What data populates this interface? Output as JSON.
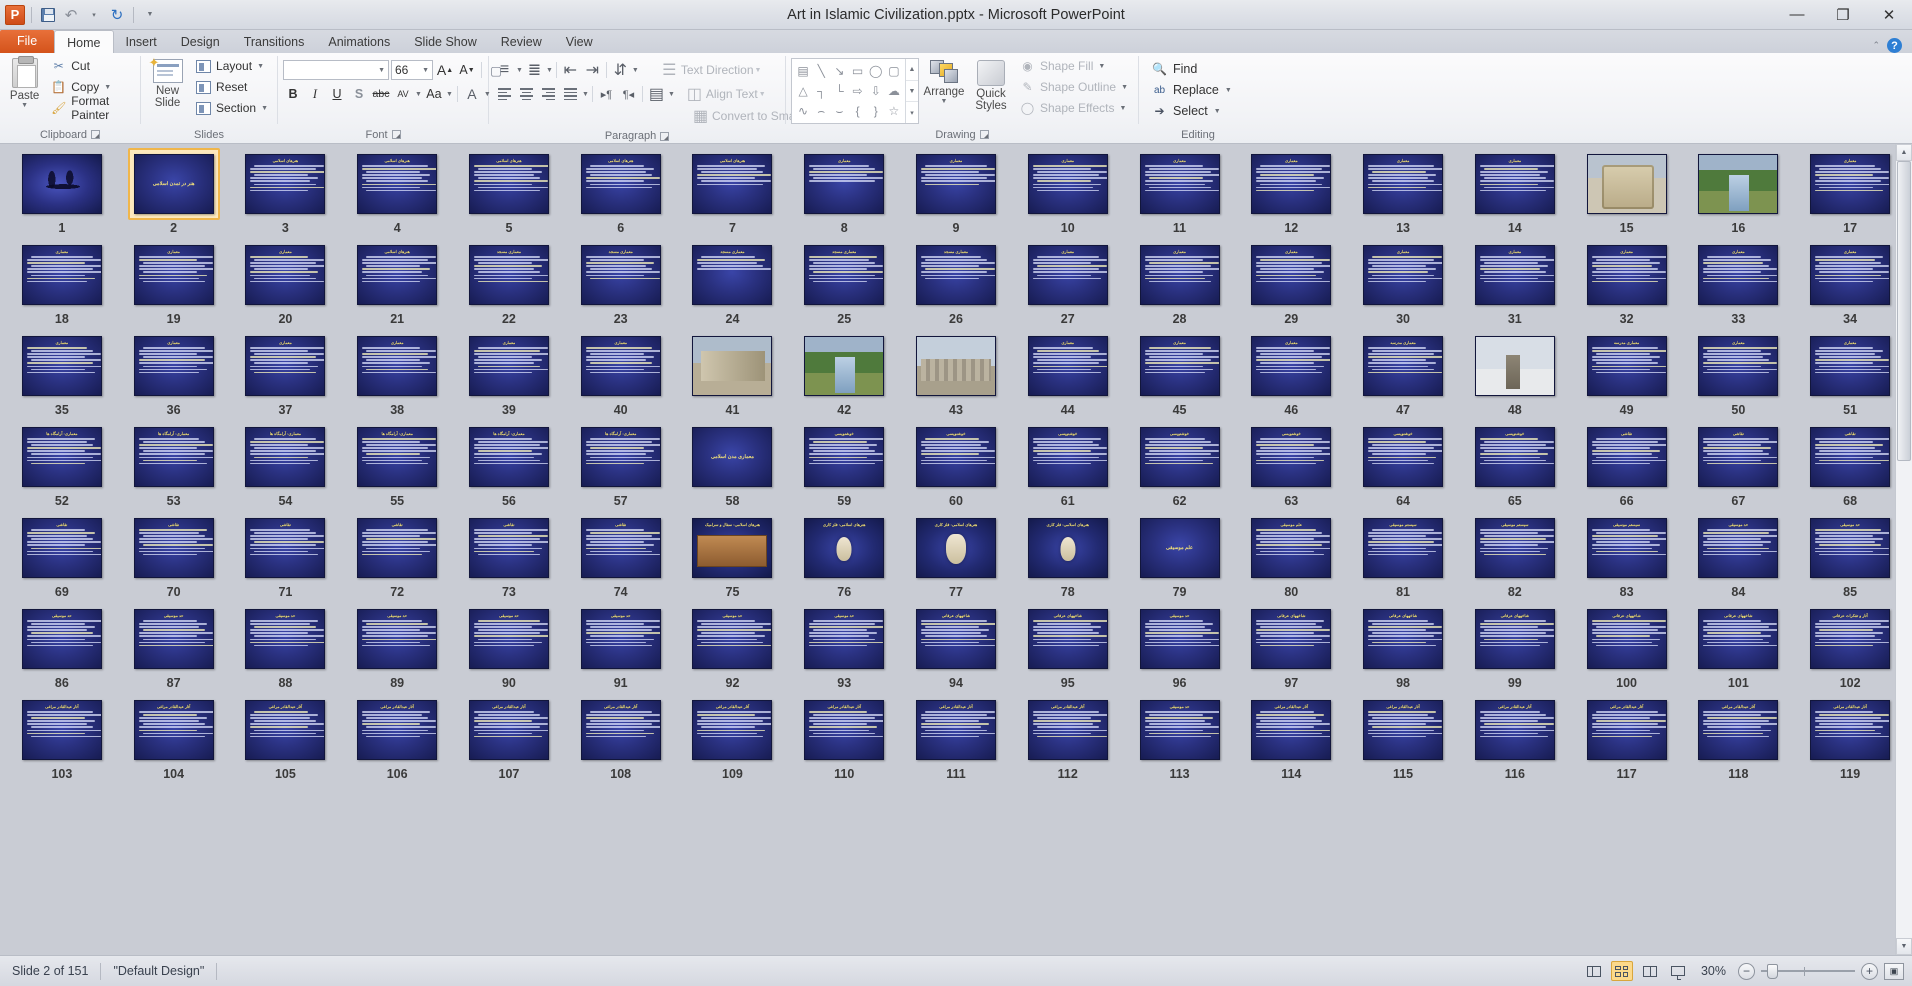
{
  "window": {
    "title": "Art in Islamic Civilization.pptx  -  Microsoft PowerPoint",
    "app_logo": "powerpoint-logo",
    "minimize": "—",
    "restore": "❐",
    "close": "✕"
  },
  "quick_access": {
    "save": "save-icon",
    "undo": "↶",
    "redo": "↺",
    "customize": "▾"
  },
  "tabs": [
    {
      "label": "File",
      "active": false,
      "special": true
    },
    {
      "label": "Home",
      "active": true
    },
    {
      "label": "Insert",
      "active": false
    },
    {
      "label": "Design",
      "active": false
    },
    {
      "label": "Transitions",
      "active": false
    },
    {
      "label": "Animations",
      "active": false
    },
    {
      "label": "Slide Show",
      "active": false
    },
    {
      "label": "Review",
      "active": false
    },
    {
      "label": "View",
      "active": false
    }
  ],
  "help": {
    "collapse": "⌃",
    "question": "?"
  },
  "ribbon": {
    "groups": [
      {
        "name": "Clipboard",
        "label": "Clipboard",
        "has_launcher": true
      },
      {
        "name": "Slides",
        "label": "Slides",
        "has_launcher": false
      },
      {
        "name": "Font",
        "label": "Font",
        "has_launcher": true
      },
      {
        "name": "Paragraph",
        "label": "Paragraph",
        "has_launcher": true
      },
      {
        "name": "Drawing",
        "label": "Drawing",
        "has_launcher": true
      },
      {
        "name": "Editing",
        "label": "Editing",
        "has_launcher": false
      }
    ],
    "clipboard": {
      "paste": "Paste",
      "cut": "Cut",
      "copy": "Copy",
      "format_painter": "Format Painter"
    },
    "slides": {
      "new_slide": "New Slide",
      "layout": "Layout",
      "reset": "Reset",
      "section": "Section"
    },
    "font": {
      "font_name": "",
      "font_size": "66",
      "bold": "B",
      "italic": "I",
      "underline": "U",
      "shadow": "S",
      "strikethrough": "abc",
      "char_spacing": "AV",
      "change_case": "Aa",
      "font_color": "A",
      "grow_font": "A",
      "shrink_font": "A",
      "clear_formatting": "clear-formatting-icon"
    },
    "paragraph": {
      "text_direction": "Text Direction",
      "align_text": "Align Text",
      "convert_to_smartart": "Convert to SmartArt"
    },
    "drawing": {
      "arrange": "Arrange",
      "quick_styles": "Quick Styles",
      "shape_fill": "Shape Fill",
      "shape_outline": "Shape Outline",
      "shape_effects": "Shape Effects",
      "shape_glyphs": [
        "▤",
        "╲",
        "↘",
        "▭",
        "◯",
        "▢",
        "△",
        "┐",
        "└",
        "⇨",
        "⇩",
        "☁",
        "∿",
        "⌢",
        "⌣",
        "{",
        "}",
        "☆"
      ]
    },
    "editing": {
      "find": "Find",
      "replace": "Replace",
      "select": "Select"
    }
  },
  "status_bar": {
    "slide_counter": "Slide 2 of 151",
    "theme": "\"Default Design\"",
    "zoom_percent": "30%",
    "views": [
      {
        "name": "normal-view",
        "active": false
      },
      {
        "name": "slide-sorter-view",
        "active": true
      },
      {
        "name": "reading-view",
        "active": false
      },
      {
        "name": "slide-show-view",
        "active": false
      }
    ],
    "zoom_out": "−",
    "zoom_in": "+",
    "fit_to_window": "fit-slide-icon"
  },
  "sorter": {
    "selected_slide": 2,
    "total_columns": 17,
    "slides": [
      {
        "n": 1,
        "kind": "calligraphy",
        "title": "",
        "lines": 0
      },
      {
        "n": 2,
        "kind": "center",
        "title": "هنر در تمدن اسلامی",
        "lines": 0
      },
      {
        "n": 3,
        "kind": "text",
        "title": "هنرهای اسلامی",
        "lines": 9
      },
      {
        "n": 4,
        "kind": "text",
        "title": "هنرهای اسلامی",
        "lines": 9
      },
      {
        "n": 5,
        "kind": "text",
        "title": "هنرهای اسلامی",
        "lines": 9
      },
      {
        "n": 6,
        "kind": "text",
        "title": "هنرهای اسلامی",
        "lines": 8
      },
      {
        "n": 7,
        "kind": "text",
        "title": "هنرهای اسلامی",
        "lines": 7
      },
      {
        "n": 8,
        "kind": "text",
        "title": "معماری",
        "lines": 6
      },
      {
        "n": 9,
        "kind": "text",
        "title": "معماری",
        "lines": 7
      },
      {
        "n": 10,
        "kind": "text",
        "title": "معماری",
        "lines": 9
      },
      {
        "n": 11,
        "kind": "text",
        "title": "معماری",
        "lines": 9
      },
      {
        "n": 12,
        "kind": "text",
        "title": "معماری",
        "lines": 9
      },
      {
        "n": 13,
        "kind": "text",
        "title": "معماری",
        "lines": 9
      },
      {
        "n": 14,
        "kind": "text",
        "title": "معماری",
        "lines": 9
      },
      {
        "n": 15,
        "kind": "photo-mosque",
        "title": "",
        "lines": 0
      },
      {
        "n": 16,
        "kind": "photo-garden",
        "title": "",
        "lines": 0
      },
      {
        "n": 17,
        "kind": "text",
        "title": "معماری",
        "lines": 9
      },
      {
        "n": 18,
        "kind": "text",
        "title": "معماری",
        "lines": 9
      },
      {
        "n": 19,
        "kind": "text",
        "title": "معماری",
        "lines": 9
      },
      {
        "n": 20,
        "kind": "text",
        "title": "معماری",
        "lines": 9
      },
      {
        "n": 21,
        "kind": "text",
        "title": "هنرهای اسلامی",
        "lines": 9
      },
      {
        "n": 22,
        "kind": "text",
        "title": "معماری مسجد",
        "lines": 9
      },
      {
        "n": 23,
        "kind": "text",
        "title": "معماری مسجد",
        "lines": 8
      },
      {
        "n": 24,
        "kind": "text",
        "title": "معماری مسجد",
        "lines": 5
      },
      {
        "n": 25,
        "kind": "text",
        "title": "معماری مسجد",
        "lines": 9
      },
      {
        "n": 26,
        "kind": "text",
        "title": "معماری مسجد",
        "lines": 8
      },
      {
        "n": 27,
        "kind": "text",
        "title": "معماری",
        "lines": 8
      },
      {
        "n": 28,
        "kind": "text",
        "title": "معماری",
        "lines": 9
      },
      {
        "n": 29,
        "kind": "text",
        "title": "معماری",
        "lines": 9
      },
      {
        "n": 30,
        "kind": "text",
        "title": "معماری",
        "lines": 9
      },
      {
        "n": 31,
        "kind": "text",
        "title": "معماری",
        "lines": 9
      },
      {
        "n": 32,
        "kind": "text",
        "title": "معماری",
        "lines": 9
      },
      {
        "n": 33,
        "kind": "text",
        "title": "معماری",
        "lines": 9
      },
      {
        "n": 34,
        "kind": "text",
        "title": "معماری",
        "lines": 9
      },
      {
        "n": 35,
        "kind": "text",
        "title": "معماری",
        "lines": 9
      },
      {
        "n": 36,
        "kind": "text",
        "title": "معماری",
        "lines": 9
      },
      {
        "n": 37,
        "kind": "text",
        "title": "معماری",
        "lines": 9
      },
      {
        "n": 38,
        "kind": "text",
        "title": "معماری",
        "lines": 9
      },
      {
        "n": 39,
        "kind": "text",
        "title": "معماری",
        "lines": 9
      },
      {
        "n": 40,
        "kind": "text",
        "title": "معماری",
        "lines": 9
      },
      {
        "n": 41,
        "kind": "photo-ruin",
        "title": "",
        "lines": 0
      },
      {
        "n": 42,
        "kind": "photo-garden",
        "title": "",
        "lines": 0
      },
      {
        "n": 43,
        "kind": "photo-city",
        "title": "",
        "lines": 0
      },
      {
        "n": 44,
        "kind": "text",
        "title": "معماری",
        "lines": 9
      },
      {
        "n": 45,
        "kind": "text",
        "title": "معماری",
        "lines": 9
      },
      {
        "n": 46,
        "kind": "text",
        "title": "معماری",
        "lines": 9
      },
      {
        "n": 47,
        "kind": "text",
        "title": "معماری مدرسه",
        "lines": 9
      },
      {
        "n": 48,
        "kind": "photo-snow",
        "title": "",
        "lines": 0
      },
      {
        "n": 49,
        "kind": "text",
        "title": "معماری مدرسه",
        "lines": 9
      },
      {
        "n": 50,
        "kind": "text",
        "title": "معماری",
        "lines": 9
      },
      {
        "n": 51,
        "kind": "text",
        "title": "معماری",
        "lines": 9
      },
      {
        "n": 52,
        "kind": "text",
        "title": "معماری: آرامگاه ها",
        "lines": 9
      },
      {
        "n": 53,
        "kind": "text",
        "title": "معماری: آرامگاه ها",
        "lines": 9
      },
      {
        "n": 54,
        "kind": "text",
        "title": "معماری: آرامگاه ها",
        "lines": 9
      },
      {
        "n": 55,
        "kind": "text",
        "title": "معماری: آرامگاه ها",
        "lines": 9
      },
      {
        "n": 56,
        "kind": "text",
        "title": "معماری: آرامگاه ها",
        "lines": 9
      },
      {
        "n": 57,
        "kind": "text",
        "title": "معماری: آرامگاه ها",
        "lines": 9
      },
      {
        "n": 58,
        "kind": "center",
        "title": "معماری مدن اسلامی",
        "lines": 0
      },
      {
        "n": 59,
        "kind": "text",
        "title": "خوشنویسی",
        "lines": 9
      },
      {
        "n": 60,
        "kind": "text",
        "title": "خوشنویسی",
        "lines": 9
      },
      {
        "n": 61,
        "kind": "text",
        "title": "خوشنویسی",
        "lines": 9
      },
      {
        "n": 62,
        "kind": "text",
        "title": "خوشنویسی",
        "lines": 9
      },
      {
        "n": 63,
        "kind": "text",
        "title": "خوشنویسی",
        "lines": 9
      },
      {
        "n": 64,
        "kind": "text",
        "title": "خوشنویسی",
        "lines": 9
      },
      {
        "n": 65,
        "kind": "text",
        "title": "خوشنویسی",
        "lines": 9
      },
      {
        "n": 66,
        "kind": "text",
        "title": "نقاشی",
        "lines": 9
      },
      {
        "n": 67,
        "kind": "text",
        "title": "نقاشی",
        "lines": 9
      },
      {
        "n": 68,
        "kind": "text",
        "title": "نقاشی",
        "lines": 9
      },
      {
        "n": 69,
        "kind": "text",
        "title": "نقاشی",
        "lines": 9
      },
      {
        "n": 70,
        "kind": "text",
        "title": "نقاشی",
        "lines": 9
      },
      {
        "n": 71,
        "kind": "text",
        "title": "نقاشی",
        "lines": 9
      },
      {
        "n": 72,
        "kind": "text",
        "title": "نقاشی",
        "lines": 9
      },
      {
        "n": 73,
        "kind": "text",
        "title": "نقاشی",
        "lines": 9
      },
      {
        "n": 74,
        "kind": "text",
        "title": "نقاشی",
        "lines": 9
      },
      {
        "n": 75,
        "kind": "photo-pots",
        "title": "هنرهای اسلامی: سفال و سرامیک",
        "lines": 0
      },
      {
        "n": 76,
        "kind": "photo-vessel",
        "title": "هنرهای اسلامی: فلز کاری",
        "lines": 0
      },
      {
        "n": 77,
        "kind": "photo-vessel",
        "title": "هنرهای اسلامی: فلز کاری",
        "lines": 0
      },
      {
        "n": 78,
        "kind": "photo-vessel",
        "title": "هنرهای اسلامی: فلز کاری",
        "lines": 0
      },
      {
        "n": 79,
        "kind": "center",
        "title": "علم موسیقی",
        "lines": 0
      },
      {
        "n": 80,
        "kind": "text",
        "title": "علم موسیقی",
        "lines": 9
      },
      {
        "n": 81,
        "kind": "text",
        "title": "سیستم موسیقی",
        "lines": 9
      },
      {
        "n": 82,
        "kind": "text",
        "title": "سیستم موسیقی",
        "lines": 9
      },
      {
        "n": 83,
        "kind": "text",
        "title": "سیستم موسیقی",
        "lines": 9
      },
      {
        "n": 84,
        "kind": "text",
        "title": "حد موسیقی",
        "lines": 9
      },
      {
        "n": 85,
        "kind": "text",
        "title": "حد موسیقی",
        "lines": 9
      },
      {
        "n": 86,
        "kind": "text",
        "title": "حد موسیقی",
        "lines": 9
      },
      {
        "n": 87,
        "kind": "text",
        "title": "حد موسیقی",
        "lines": 9
      },
      {
        "n": 88,
        "kind": "text",
        "title": "حد موسیقی",
        "lines": 9
      },
      {
        "n": 89,
        "kind": "text",
        "title": "حد موسیقی",
        "lines": 9
      },
      {
        "n": 90,
        "kind": "text",
        "title": "حد موسیقی",
        "lines": 9
      },
      {
        "n": 91,
        "kind": "text",
        "title": "حد موسیقی",
        "lines": 9
      },
      {
        "n": 92,
        "kind": "text",
        "title": "حد موسیقی",
        "lines": 9
      },
      {
        "n": 93,
        "kind": "text",
        "title": "حد موسیقی",
        "lines": 9
      },
      {
        "n": 94,
        "kind": "text",
        "title": "شاخههای عرفانی",
        "lines": 9
      },
      {
        "n": 95,
        "kind": "text",
        "title": "شاخههای عرفانی",
        "lines": 9
      },
      {
        "n": 96,
        "kind": "text",
        "title": "حد موسیقی",
        "lines": 9
      },
      {
        "n": 97,
        "kind": "text",
        "title": "شاخههای عرفانی",
        "lines": 9
      },
      {
        "n": 98,
        "kind": "text",
        "title": "شاخههای عرفانی",
        "lines": 9
      },
      {
        "n": 99,
        "kind": "text",
        "title": "شاخههای عرفانی",
        "lines": 9
      },
      {
        "n": 100,
        "kind": "text",
        "title": "شاخههای عرفانی",
        "lines": 9
      },
      {
        "n": 101,
        "kind": "text",
        "title": "شاخههای عرفانی",
        "lines": 9
      },
      {
        "n": 102,
        "kind": "text",
        "title": "آثار و تفکرات عرفانی",
        "lines": 9
      },
      {
        "n": 103,
        "kind": "text",
        "title": "آثار عبدالقادر مراغی",
        "lines": 9
      },
      {
        "n": 104,
        "kind": "text",
        "title": "آثار عبدالقادر مراغی",
        "lines": 9
      },
      {
        "n": 105,
        "kind": "text",
        "title": "آثار عبدالقادر مراغی",
        "lines": 9
      },
      {
        "n": 106,
        "kind": "text",
        "title": "آثار عبدالقادر مراغی",
        "lines": 9
      },
      {
        "n": 107,
        "kind": "text",
        "title": "آثار عبدالقادر مراغی",
        "lines": 9
      },
      {
        "n": 108,
        "kind": "text",
        "title": "آثار عبدالقادر مراغی",
        "lines": 9
      },
      {
        "n": 109,
        "kind": "text",
        "title": "آثار عبدالقادر مراغی",
        "lines": 9
      },
      {
        "n": 110,
        "kind": "text",
        "title": "آثار عبدالقادر مراغی",
        "lines": 9
      },
      {
        "n": 111,
        "kind": "text",
        "title": "آثار عبدالقادر مراغی",
        "lines": 9
      },
      {
        "n": 112,
        "kind": "text",
        "title": "آثار عبدالقادر مراغی",
        "lines": 9
      },
      {
        "n": 113,
        "kind": "text",
        "title": "حد موسیقی",
        "lines": 9
      },
      {
        "n": 114,
        "kind": "text",
        "title": "آثار عبدالقادر مراغی",
        "lines": 9
      },
      {
        "n": 115,
        "kind": "text",
        "title": "آثار عبدالقادر مراغی",
        "lines": 9
      },
      {
        "n": 116,
        "kind": "text",
        "title": "آثار عبدالقادر مراغی",
        "lines": 9
      },
      {
        "n": 117,
        "kind": "text",
        "title": "آثار عبدالقادر مراغی",
        "lines": 9
      },
      {
        "n": 118,
        "kind": "text",
        "title": "آثار عبدالقادر مراغی",
        "lines": 9
      },
      {
        "n": 119,
        "kind": "text",
        "title": "آثار عبدالقادر مراغی",
        "lines": 9
      }
    ]
  }
}
